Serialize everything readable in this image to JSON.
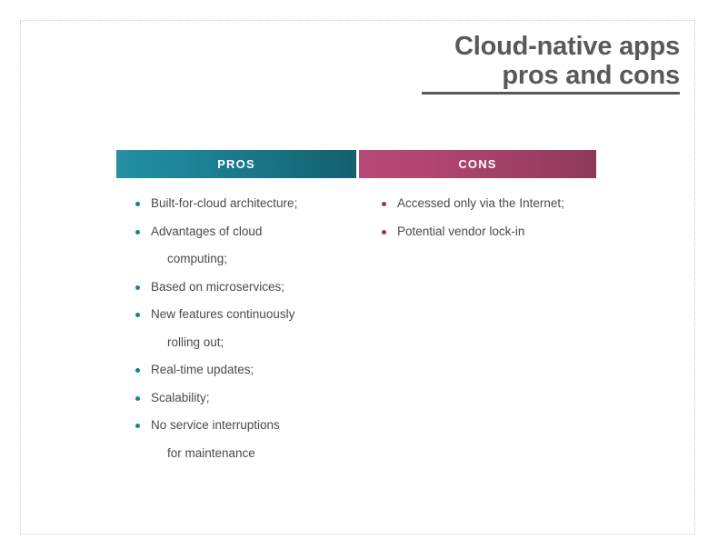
{
  "slide": {
    "title": {
      "line1": "Cloud-native apps",
      "line2": "pros and cons"
    },
    "columns": [
      {
        "header": "PROS",
        "accent_color": "#1d7f8e",
        "bar_gradient_from": "#2491a3",
        "bar_gradient_to": "#155f6d",
        "items": [
          {
            "text": "Built-for-cloud architecture;",
            "continuation": ""
          },
          {
            "text": "Advantages of cloud",
            "continuation": "computing;"
          },
          {
            "text": "Based on microservices;",
            "continuation": ""
          },
          {
            "text": "New features continuously",
            "continuation": "rolling out;"
          },
          {
            "text": "Real-time updates;",
            "continuation": ""
          },
          {
            "text": "Scalability;",
            "continuation": ""
          },
          {
            "text": "No service interruptions",
            "continuation": "for maintenance"
          }
        ]
      },
      {
        "header": "CONS",
        "accent_color": "#9b3556",
        "bar_gradient_from": "#b94a77",
        "bar_gradient_to": "#8e3a59",
        "items": [
          {
            "text": "Accessed only via the Internet;",
            "continuation": ""
          },
          {
            "text": "Potential vendor lock-in",
            "continuation": ""
          }
        ]
      }
    ],
    "title_color": "#595959",
    "body_text_color": "#4a4a4a",
    "background_color": "#ffffff",
    "frame_color": "#c9c9d1"
  }
}
